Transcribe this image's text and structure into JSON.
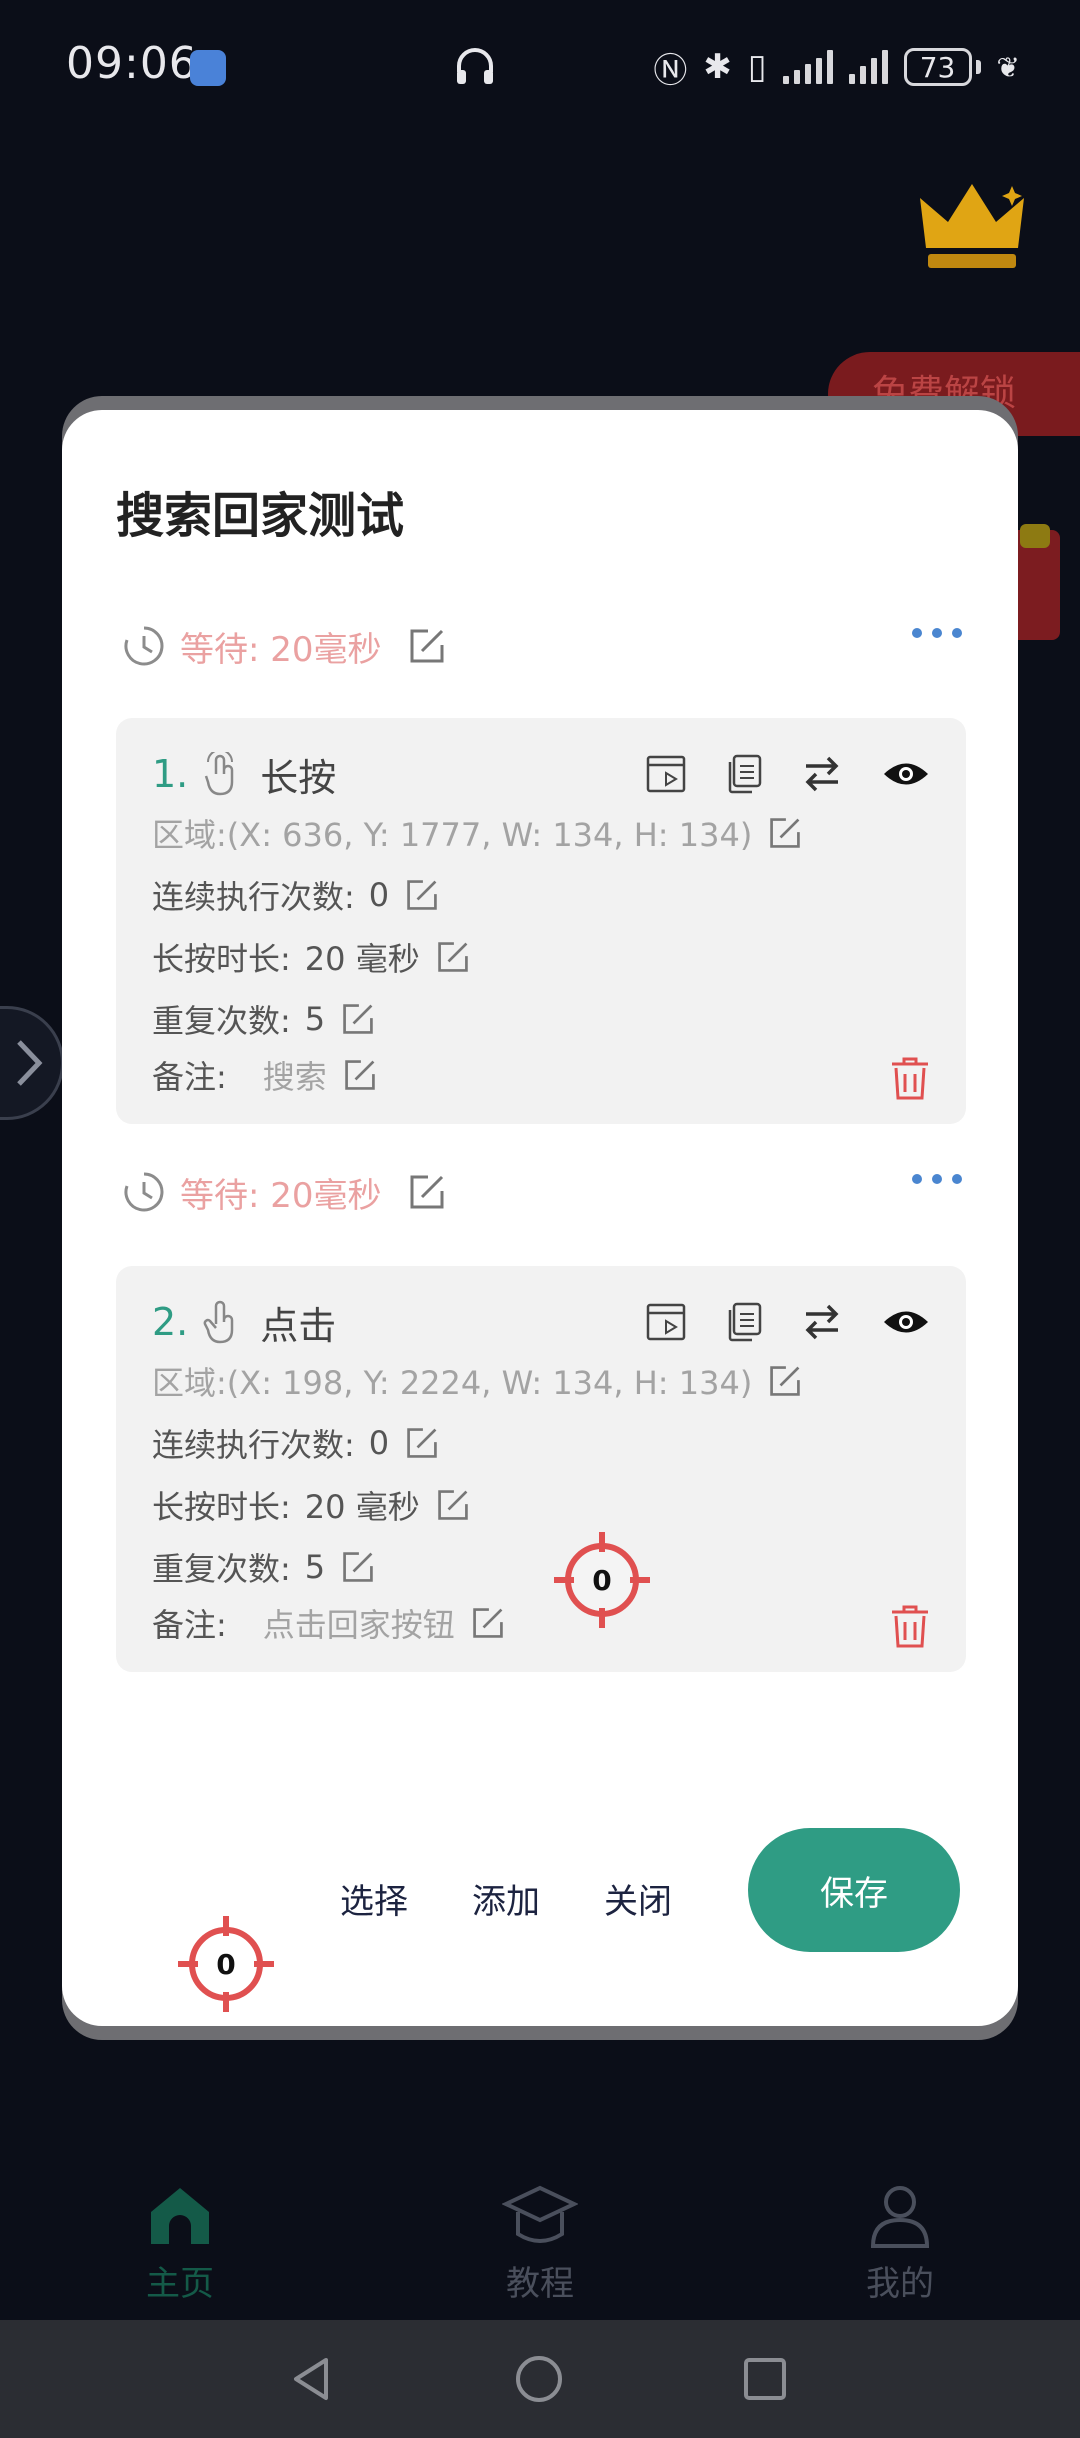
{
  "status_bar": {
    "time": "09:06",
    "battery": "73"
  },
  "background": {
    "unlock_button": "免费解锁",
    "nav": [
      {
        "label": "主页",
        "icon": "home-icon",
        "active": true
      },
      {
        "label": "教程",
        "icon": "graduation-cap-icon",
        "active": false
      },
      {
        "label": "我的",
        "icon": "user-icon",
        "active": false
      }
    ]
  },
  "dialog": {
    "title": "搜索回家测试",
    "wait_rows": [
      {
        "text": "等待: 20毫秒"
      },
      {
        "text": "等待: 20毫秒"
      }
    ],
    "cards": [
      {
        "number": "1.",
        "type": "长按",
        "type_icon": "long-press-hand-icon",
        "region": "区域:(X: 636, Y: 1777, W: 134, H: 134)",
        "consecutive_label": "连续执行次数:",
        "consecutive_value": "0",
        "duration_label": "长按时长:",
        "duration_value": "20 毫秒",
        "repeat_label": "重复次数:",
        "repeat_value": "5",
        "note_label": "备注:",
        "note_value": "搜索"
      },
      {
        "number": "2.",
        "type": "点击",
        "type_icon": "tap-hand-icon",
        "region": "区域:(X: 198, Y: 2224, W: 134, H: 134)",
        "consecutive_label": "连续执行次数:",
        "consecutive_value": "0",
        "duration_label": "长按时长:",
        "duration_value": "20 毫秒",
        "repeat_label": "重复次数:",
        "repeat_value": "5",
        "note_label": "备注:",
        "note_value": "点击回家按钮"
      }
    ],
    "actions": {
      "select": "选择",
      "add": "添加",
      "close": "关闭",
      "save": "保存"
    }
  },
  "markers": [
    {
      "label": "0"
    },
    {
      "label": "0"
    }
  ],
  "colors": {
    "accent": "#2f9c84",
    "wait_text": "#eaa1a1",
    "marker_red": "#e05050",
    "more_dots": "#4a86d0"
  }
}
